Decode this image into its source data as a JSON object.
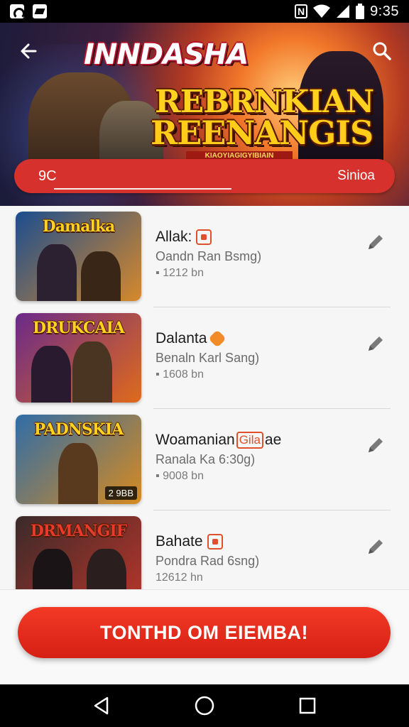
{
  "status_bar": {
    "time": "9:35",
    "icons": [
      "notification-icon",
      "image-icon",
      "nfc-icon",
      "wifi-icon",
      "signal-icon",
      "battery-icon"
    ]
  },
  "header": {
    "app_logo": "INNDASHA",
    "title_line1": "REBRNKIAN",
    "title_line2": "REENANGIS",
    "ribbon_text": "KIAOYIAGIGYIBIAIN",
    "search": {
      "query": "9C",
      "submit_label": "Sinioa"
    }
  },
  "list": {
    "items": [
      {
        "thumb_title": "Damalka",
        "thumb_colors": [
          "#1b4d8f",
          "#d7892a"
        ],
        "name": "Allak:",
        "tag": "square",
        "subtitle": "Oandn Ran Bsmg)",
        "size": "1212 bn",
        "badge": ""
      },
      {
        "thumb_title": "DRUKCAIA",
        "thumb_colors": [
          "#6a2a8a",
          "#e06a1a"
        ],
        "name": "Dalanta",
        "tag": "gem",
        "subtitle": "Benaln Karl Sang)",
        "size": "1608 bn",
        "badge": ""
      },
      {
        "thumb_title": "PADNSKIA",
        "thumb_colors": [
          "#2f6da8",
          "#d88a1e"
        ],
        "name": "Woamanian",
        "tag_text": "Gila",
        "name_suffix": "ae",
        "tag": "square",
        "subtitle": "Ranala Ka 6:30g)",
        "size": "9008 bn",
        "badge": "2 9BB"
      },
      {
        "thumb_title": "DRMANGIF",
        "thumb_colors": [
          "#3a2a2a",
          "#b8352a"
        ],
        "name": "Bahate",
        "tag": "square",
        "subtitle": "Pondra Rad 6sng)",
        "size": "12612 hn",
        "badge": ""
      }
    ]
  },
  "cta": {
    "label": "TONTHD OM EIEMBA!"
  },
  "colors": {
    "accent": "#d6312c",
    "cta": "#e52b1d"
  }
}
